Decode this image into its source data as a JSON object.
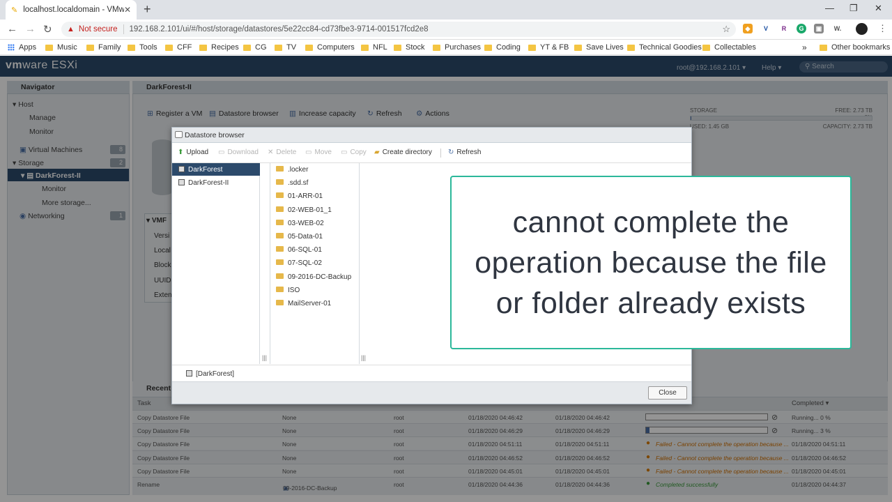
{
  "browser": {
    "tab_title": "localhost.localdomain - VMware",
    "not_secure": "Not secure",
    "url": "192.168.2.101/ui/#/host/storage/datastores/5e22cc84-cd73fbe3-9714-001517fcd2e8",
    "bookmarks": [
      "Apps",
      "Music",
      "Family",
      "Tools",
      "CFF",
      "Recipes",
      "CG",
      "TV",
      "Computers",
      "NFL",
      "Stock",
      "Purchases",
      "Coding",
      "YT & FB",
      "Save Lives",
      "Technical Goodies",
      "Collectables"
    ],
    "other_bookmarks": "Other bookmarks",
    "overflow": "»"
  },
  "esxi": {
    "logo_a": "vm",
    "logo_b": "ware",
    "logo_c": " ESXi",
    "user": "root@192.168.2.101 ▾",
    "help": "Help ▾",
    "search_placeholder": "Search"
  },
  "navigator": {
    "title": "Navigator",
    "host": "Host",
    "manage": "Manage",
    "monitor": "Monitor",
    "virtual_machines": "Virtual Machines",
    "vm_count": "8",
    "storage": "Storage",
    "storage_count": "2",
    "datastore": "DarkForest-II",
    "ds_monitor": "Monitor",
    "more_storage": "More storage...",
    "networking": "Networking",
    "net_count": "1"
  },
  "content": {
    "title": "DarkForest-II",
    "toolbar": [
      "Register a VM",
      "Datastore browser",
      "Increase capacity",
      "Refresh",
      "Actions"
    ],
    "storage_label": "STORAGE",
    "free": "FREE: 2.73 TB",
    "pct": "0%",
    "used": "USED: 1.45 GB",
    "capacity": "CAPACITY: 2.73 TB",
    "used_fraction": 0.001,
    "vmfs_label": "VMF",
    "vmfs_rows": [
      "Versi",
      "Local",
      "Block",
      "UUID",
      "Exten"
    ]
  },
  "recent_tasks": {
    "title": "Recent",
    "col_task": "Task",
    "col_completed": "Completed ▾",
    "rows": [
      {
        "task": "Copy Datastore File",
        "target": "None",
        "initiator": "root",
        "queued": "01/18/2020 04:46:42",
        "started": "01/18/2020 04:46:42",
        "result": "",
        "progress": 0.0,
        "completed": "Running... 0 %"
      },
      {
        "task": "Copy Datastore File",
        "target": "None",
        "initiator": "root",
        "queued": "01/18/2020 04:46:29",
        "started": "01/18/2020 04:46:29",
        "result": "",
        "progress": 0.03,
        "completed": "Running... 3 %"
      },
      {
        "task": "Copy Datastore File",
        "target": "None",
        "initiator": "root",
        "queued": "01/18/2020 04:51:11",
        "started": "01/18/2020 04:51:11",
        "result": "Failed - Cannot complete the operation because ...",
        "completed": "01/18/2020 04:51:11"
      },
      {
        "task": "Copy Datastore File",
        "target": "None",
        "initiator": "root",
        "queued": "01/18/2020 04:46:52",
        "started": "01/18/2020 04:46:52",
        "result": "Failed - Cannot complete the operation because ...",
        "completed": "01/18/2020 04:46:52"
      },
      {
        "task": "Copy Datastore File",
        "target": "None",
        "initiator": "root",
        "queued": "01/18/2020 04:45:01",
        "started": "01/18/2020 04:45:01",
        "result": "Failed - Cannot complete the operation because ...",
        "completed": "01/18/2020 04:45:01"
      },
      {
        "task": "Rename",
        "target": "09-2016-DC-Backup",
        "initiator": "root",
        "queued": "01/18/2020 04:44:36",
        "started": "01/18/2020 04:44:36",
        "result": "Completed successfully",
        "completed": "01/18/2020 04:44:37"
      }
    ]
  },
  "dialog": {
    "title": "Datastore browser",
    "toolbar": {
      "upload": "Upload",
      "download": "Download",
      "delete": "Delete",
      "move": "Move",
      "copy": "Copy",
      "create_directory": "Create directory",
      "refresh": "Refresh"
    },
    "datastores": [
      "DarkForest",
      "DarkForest-II"
    ],
    "folders": [
      ".locker",
      ".sdd.sf",
      "01-ARR-01",
      "02-WEB-01_1",
      "03-WEB-02",
      "05-Data-01",
      "06-SQL-01",
      "07-SQL-02",
      "09-2016-DC-Backup",
      "ISO",
      "MailServer-01"
    ],
    "path": "[DarkForest]",
    "close": "Close"
  },
  "caption": "cannot complete the operation because the file or folder already exists"
}
